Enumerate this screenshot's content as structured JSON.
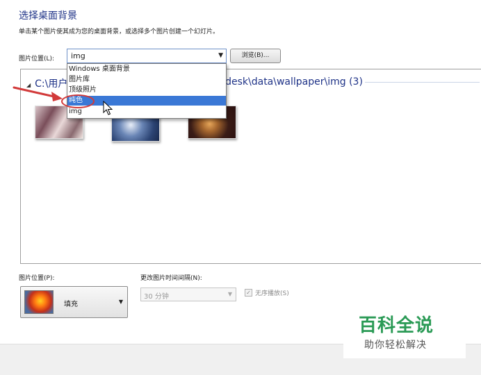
{
  "header": {
    "title": "选择桌面背景",
    "subtitle": "单击某个图片使其成为您的桌面背景，或选择多个图片创建一个幻灯片。"
  },
  "location": {
    "label": "图片位置(L):",
    "value": "img",
    "browse_label": "浏览(B)...",
    "options": [
      "Windows 桌面背景",
      "图片库",
      "顶级照片",
      "纯色",
      "img"
    ],
    "selected_option": "纯色"
  },
  "gallery": {
    "group_title": "C:\\用户\\",
    "group_title_right": "kdesk\\data\\wallpaper\\img (3)"
  },
  "position": {
    "label": "图片位置(P):",
    "value": "填充"
  },
  "interval": {
    "label": "更改图片时间间隔(N):",
    "value": "30 分钟"
  },
  "shuffle": {
    "label": "无序播放(S)",
    "checked": true
  },
  "watermark": {
    "title": "百科全说",
    "subtitle": "助你轻松解决"
  },
  "colors": {
    "accent": "#1e3287",
    "selection": "#3a78d6",
    "annotation": "#d23a3a",
    "watermark": "#2a9a55"
  }
}
